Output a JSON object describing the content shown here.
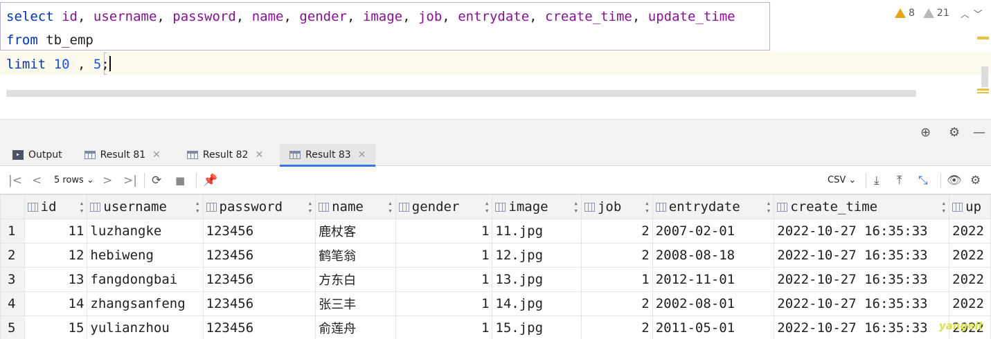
{
  "editor": {
    "line1": {
      "kw": "select",
      "cols": [
        "id",
        "username",
        "password",
        "name",
        "gender",
        "image",
        "job",
        "entrydate",
        "create_time",
        "update_time"
      ]
    },
    "line2": {
      "kw": "from",
      "table": "tb_emp"
    },
    "line3": {
      "kw": "limit",
      "offset": "10",
      "sep": ",",
      "count": "5",
      "end": ";"
    },
    "inspections": {
      "warnings": "8",
      "weak_warnings": "21"
    }
  },
  "tabs": [
    {
      "label": "Output",
      "icon": "console-icon",
      "active": false
    },
    {
      "label": "Result 81",
      "icon": "table-icon",
      "active": false
    },
    {
      "label": "Result 82",
      "icon": "table-icon",
      "active": false
    },
    {
      "label": "Result 83",
      "icon": "table-icon",
      "active": true
    }
  ],
  "toolbar": {
    "rows_label": "5 rows",
    "export_format": "CSV"
  },
  "grid": {
    "columns": [
      "id",
      "username",
      "password",
      "name",
      "gender",
      "image",
      "job",
      "entrydate",
      "create_time",
      "up"
    ],
    "rows": [
      {
        "rn": "1",
        "id": "11",
        "username": "luzhangke",
        "password": "123456",
        "name": "鹿杖客",
        "gender": "1",
        "image": "11.jpg",
        "job": "2",
        "entrydate": "2007-02-01",
        "create_time": "2022-10-27 16:35:33",
        "update_time": "2022"
      },
      {
        "rn": "2",
        "id": "12",
        "username": "hebiweng",
        "password": "123456",
        "name": "鹤笔翁",
        "gender": "1",
        "image": "12.jpg",
        "job": "2",
        "entrydate": "2008-08-18",
        "create_time": "2022-10-27 16:35:33",
        "update_time": "2022"
      },
      {
        "rn": "3",
        "id": "13",
        "username": "fangdongbai",
        "password": "123456",
        "name": "方东白",
        "gender": "1",
        "image": "13.jpg",
        "job": "1",
        "entrydate": "2012-11-01",
        "create_time": "2022-10-27 16:35:33",
        "update_time": "2022"
      },
      {
        "rn": "4",
        "id": "14",
        "username": "zhangsanfeng",
        "password": "123456",
        "name": "张三丰",
        "gender": "1",
        "image": "14.jpg",
        "job": "2",
        "entrydate": "2002-08-01",
        "create_time": "2022-10-27 16:35:33",
        "update_time": "2022"
      },
      {
        "rn": "5",
        "id": "15",
        "username": "yulianzhou",
        "password": "123456",
        "name": "俞莲舟",
        "gender": "1",
        "image": "15.jpg",
        "job": "2",
        "entrydate": "2011-05-01",
        "create_time": "2022-10-27 16:35:33",
        "update_time": "2022"
      }
    ]
  },
  "watermark": "yangeit"
}
